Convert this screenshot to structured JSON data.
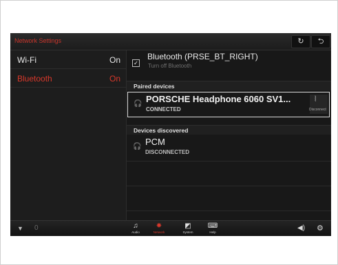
{
  "header": {
    "title": "Network Settings",
    "refresh_icon": "refresh-icon",
    "back_icon": "back-icon"
  },
  "sidebar": {
    "items": [
      {
        "label": "Wi-Fi",
        "value": "On",
        "active": false
      },
      {
        "label": "Bluetooth",
        "value": "On",
        "active": true
      }
    ]
  },
  "bluetooth": {
    "name": "Bluetooth (PRSE_BT_RIGHT)",
    "sub": "Turn off Bluetooth",
    "checked": true
  },
  "paired": {
    "heading": "Paired devices",
    "device": {
      "name": "PORSCHE Headphone 6060 SV1...",
      "status": "CONNECTED",
      "action": "Disconnect"
    }
  },
  "discovered": {
    "heading": "Devices discovered",
    "device": {
      "name": "PCM",
      "status": "DISCONNECTED"
    }
  },
  "bottom": {
    "signal_value": "0",
    "tabs": [
      {
        "label": "Audio",
        "icon": "music-icon",
        "active": false
      },
      {
        "label": "Network",
        "icon": "network-icon",
        "active": true
      },
      {
        "label": "System",
        "icon": "system-icon",
        "active": false
      },
      {
        "label": "Help",
        "icon": "help-icon",
        "active": false
      }
    ]
  },
  "colors": {
    "accent": "#d8382b",
    "background": "#161616"
  }
}
